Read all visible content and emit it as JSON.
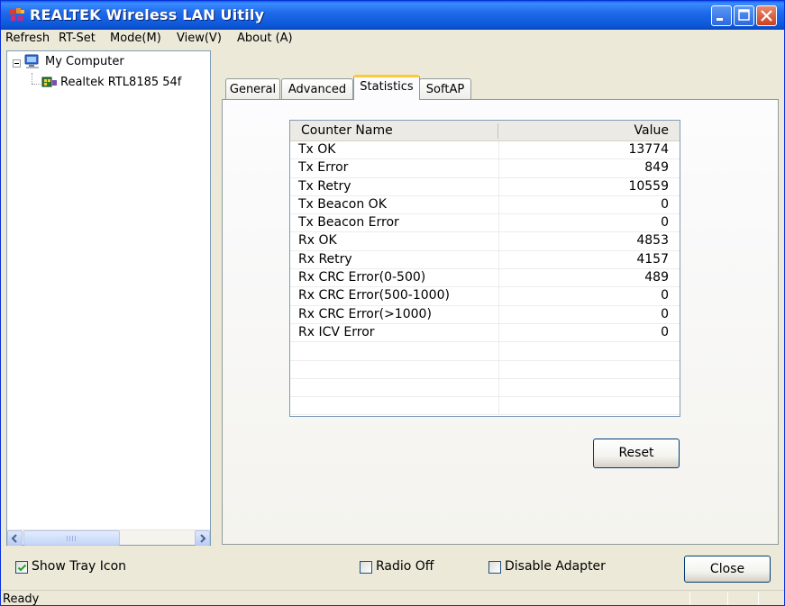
{
  "window": {
    "title": "REALTEK Wireless LAN Uitily",
    "icon": "realtek-app-icon"
  },
  "menu": {
    "items": [
      {
        "label": "Refresh"
      },
      {
        "label": "RT-Set"
      },
      {
        "label": "Mode(M)"
      },
      {
        "label": "View(V)"
      },
      {
        "label": "About (A)"
      }
    ]
  },
  "tree": {
    "root_label": "My Computer",
    "root_icon": "computer-icon",
    "child_label": "Realtek RTL8185 54f",
    "child_icon": "network-adapter-icon"
  },
  "tabs": [
    {
      "label": "General"
    },
    {
      "label": "Advanced"
    },
    {
      "label": "Statistics",
      "active": true
    },
    {
      "label": "SoftAP"
    }
  ],
  "statistics": {
    "columns": {
      "name": "Counter Name",
      "value": "Value"
    },
    "rows": [
      {
        "name": "Tx OK",
        "value": "13774"
      },
      {
        "name": "Tx Error",
        "value": "849"
      },
      {
        "name": "Tx Retry",
        "value": "10559"
      },
      {
        "name": "Tx Beacon OK",
        "value": "0"
      },
      {
        "name": "Tx Beacon Error",
        "value": "0"
      },
      {
        "name": "Rx OK",
        "value": "4853"
      },
      {
        "name": "Rx Retry",
        "value": "4157"
      },
      {
        "name": "Rx CRC Error(0-500)",
        "value": "489"
      },
      {
        "name": "Rx CRC Error(500-1000)",
        "value": "0"
      },
      {
        "name": "Rx CRC Error(>1000)",
        "value": "0"
      },
      {
        "name": "Rx ICV Error",
        "value": "0"
      }
    ],
    "reset_label": "Reset"
  },
  "bottom": {
    "show_tray_icon": {
      "label": "Show Tray Icon",
      "checked": true
    },
    "radio_off": {
      "label": "Radio Off",
      "checked": false
    },
    "disable_adapter": {
      "label": "Disable Adapter",
      "checked": false
    },
    "close_label": "Close"
  },
  "status": {
    "text": "Ready"
  },
  "colors": {
    "titlebar": "#0A5FE0",
    "tab_highlight": "#FFC83C",
    "window_bg": "#ECE9D8"
  }
}
